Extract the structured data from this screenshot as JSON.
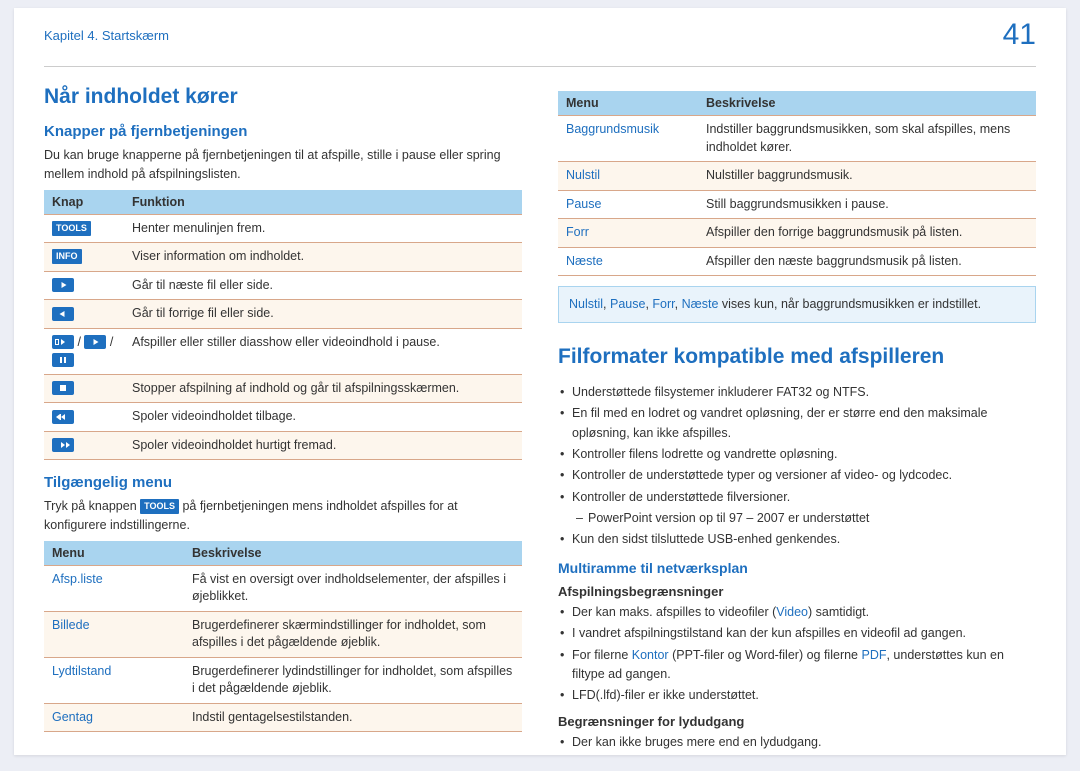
{
  "header": {
    "breadcrumb": "Kapitel 4. Startskærm",
    "page_number": "41"
  },
  "left": {
    "h1": "Når indholdet kører",
    "sec1": {
      "title": "Knapper på fjernbetjeningen",
      "desc": "Du kan bruge knapperne på fjernbetjeningen til at afspille, stille i pause eller spring mellem indhold på afspilningslisten.",
      "th1": "Knap",
      "th2": "Funktion",
      "rows": [
        {
          "k": "TOOLS",
          "d": "Henter menulinjen frem."
        },
        {
          "k": "INFO",
          "d": "Viser information om indholdet."
        },
        {
          "d": "Går til næste fil eller side."
        },
        {
          "d": "Går til forrige fil eller side."
        },
        {
          "d": "Afspiller eller stiller diasshow eller videoindhold i pause."
        },
        {
          "d": "Stopper afspilning af indhold og går til afspilningsskærmen."
        },
        {
          "d": "Spoler videoindholdet tilbage."
        },
        {
          "d": "Spoler videoindholdet hurtigt fremad."
        }
      ]
    },
    "sec2": {
      "title": "Tilgængelig menu",
      "desc_a": "Tryk på knappen ",
      "desc_tag": "TOOLS",
      "desc_b": " på fjernbetjeningen mens indholdet afspilles for at konfigurere indstillingerne.",
      "th1": "Menu",
      "th2": "Beskrivelse",
      "rows": [
        {
          "k": "Afsp.liste",
          "d": "Få vist en oversigt over indholdselementer, der afspilles i øjeblikket."
        },
        {
          "k": "Billede",
          "d": "Brugerdefinerer skærmindstillinger for indholdet, som afspilles i det pågældende øjeblik."
        },
        {
          "k": "Lydtilstand",
          "d": "Brugerdefinerer lydindstillinger for indholdet, som afspilles i det pågældende øjeblik."
        },
        {
          "k": "Gentag",
          "d": "Indstil gentagelsestilstanden."
        }
      ]
    }
  },
  "right": {
    "table1": {
      "th1": "Menu",
      "th2": "Beskrivelse",
      "rows": [
        {
          "k": "Baggrundsmusik",
          "d": "Indstiller baggrundsmusikken, som skal afspilles, mens indholdet kører."
        },
        {
          "k": "Nulstil",
          "d": "Nulstiller baggrundsmusik."
        },
        {
          "k": "Pause",
          "d": "Still baggrundsmusikken i pause."
        },
        {
          "k": "Forr",
          "d": "Afspiller den forrige baggrundsmusik på listen."
        },
        {
          "k": "Næste",
          "d": "Afspiller den næste baggrundsmusik på listen."
        }
      ]
    },
    "note": {
      "t1": "Nulstil",
      "t2": "Pause",
      "t3": "Forr",
      "t4": "Næste",
      "rest": " vises kun, når baggrundsmusikken er indstillet."
    },
    "h1b": "Filformater kompatible med afspilleren",
    "bul1": [
      "Understøttede filsystemer inkluderer FAT32 og NTFS.",
      "En fil med en lodret og vandret opløsning, der er større end den maksimale opløsning, kan ikke afspilles.",
      "Kontroller filens lodrette og vandrette opløsning.",
      "Kontroller de understøttede typer og versioner af video- og lydcodec.",
      "Kontroller de understøttede filversioner."
    ],
    "sub1": "PowerPoint version op til 97 – 2007 er understøttet",
    "bul1b": "Kun den sidst tilsluttede USB-enhed genkendes.",
    "h2b": "Multiramme til netværksplan",
    "h4a": "Afspilningsbegrænsninger",
    "bul2_a": "Der kan maks. afspilles to videofiler (",
    "bul2_a_link": "Video",
    "bul2_a2": ") samtidigt.",
    "bul2_b": "I vandret afspilningstilstand kan der kun afspilles en videofil ad gangen.",
    "bul2_c1": "For filerne ",
    "bul2_c_link1": "Kontor",
    "bul2_c2": " (PPT-filer og Word-filer) og filerne ",
    "bul2_c_link2": "PDF",
    "bul2_c3": ", understøttes kun en filtype ad gangen.",
    "bul2_d": "LFD(.lfd)-filer er ikke understøttet.",
    "h4b": "Begrænsninger for lydudgang",
    "bul3": "Der kan ikke bruges mere end en lydudgang."
  }
}
